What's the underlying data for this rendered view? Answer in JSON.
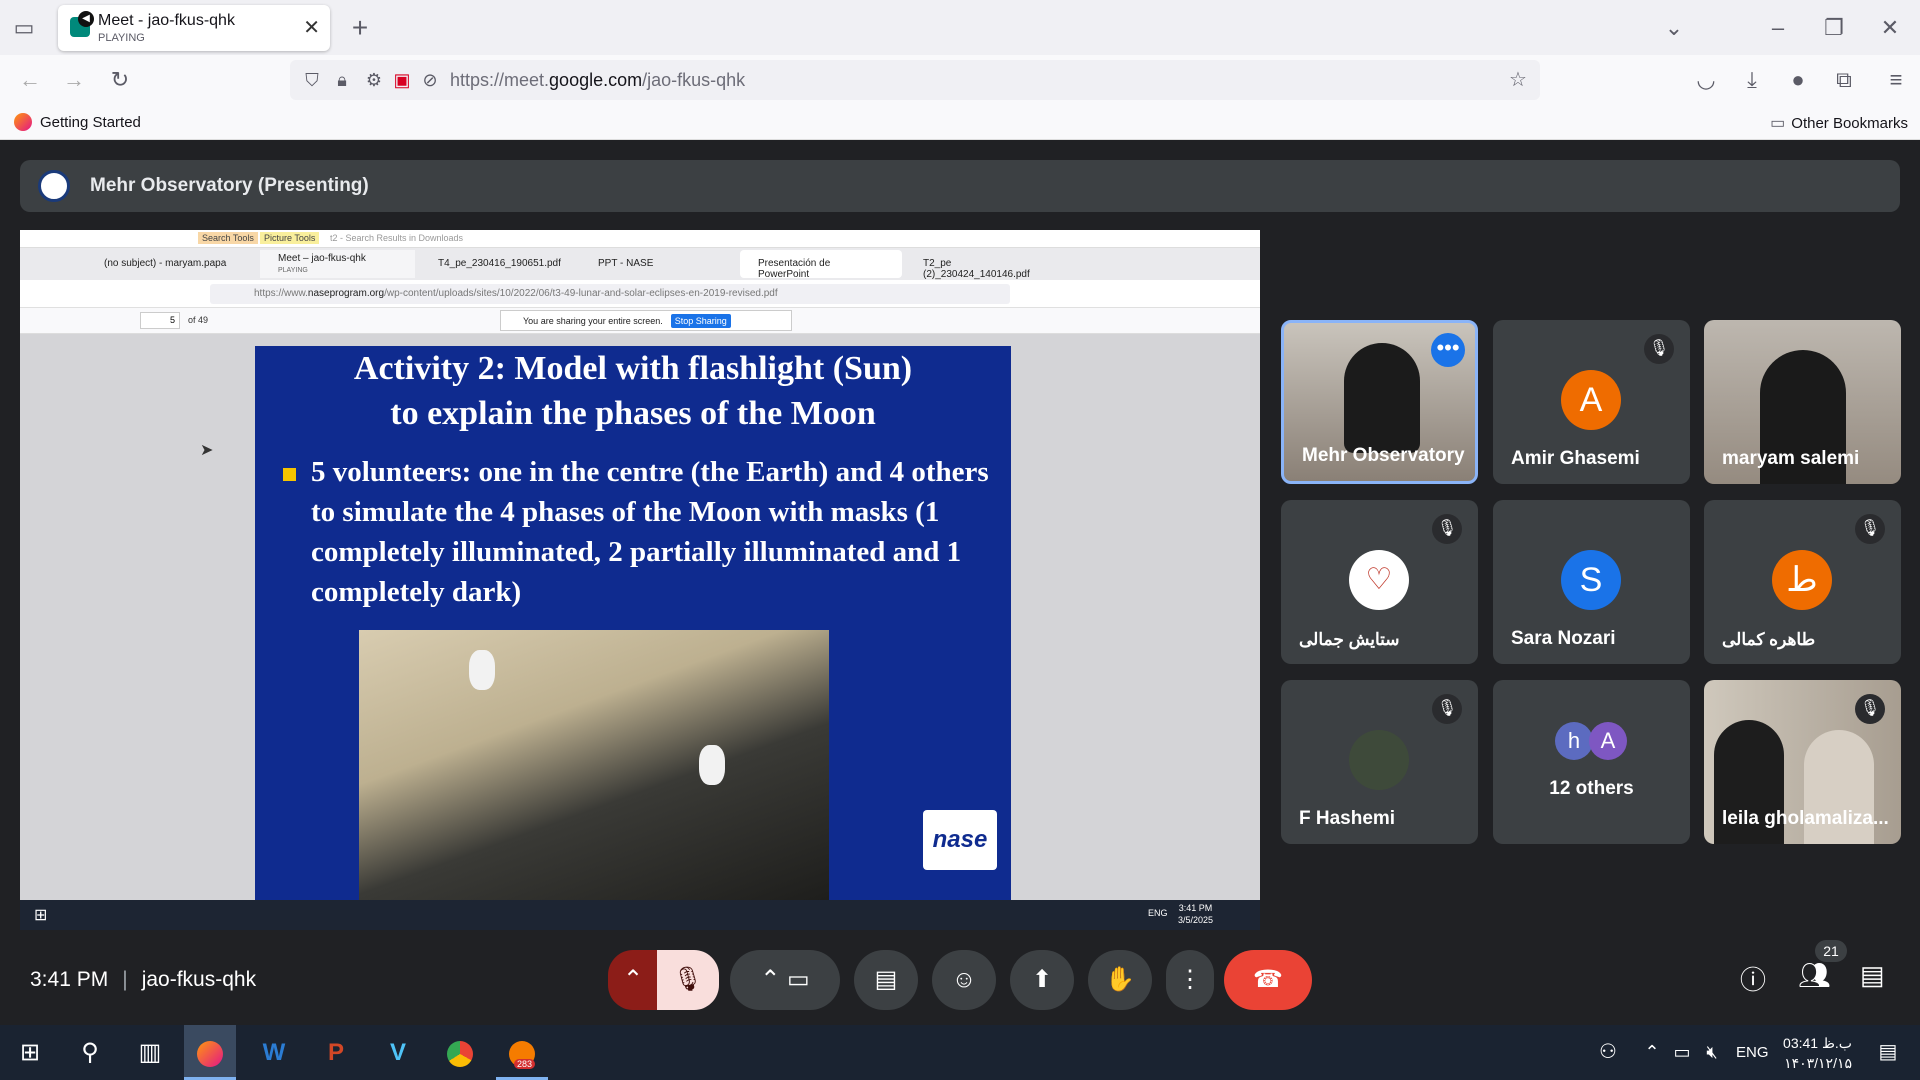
{
  "browser": {
    "tab_title": "Meet - jao-fkus-qhk",
    "tab_status": "PLAYING",
    "url_prefix": "https://meet.",
    "url_domain": "google.com",
    "url_path": "/jao-fkus-qhk",
    "bookmark": "Getting Started",
    "other_bookmarks": "Other Bookmarks"
  },
  "presenting": {
    "label": "Mehr Observatory (Presenting)"
  },
  "shared_screen": {
    "ribbon_search": "Search Tools",
    "ribbon_picture": "Picture Tools",
    "ribbon_doc": "t2 - Search Results in Downloads",
    "tabs": [
      {
        "label": "(no subject) - maryam.papa"
      },
      {
        "label": "Meet – jao-fkus-qhk",
        "sub": "PLAYING"
      },
      {
        "label": "T4_pe_230416_190651.pdf"
      },
      {
        "label": "PPT - NASE"
      },
      {
        "label": "Presentación de PowerPoint"
      },
      {
        "label": "T2_pe (2)_230424_140146.pdf"
      }
    ],
    "url_prefix": "https://www.",
    "url_domain": "naseprogram.org",
    "url_path": "/wp-content/uploads/sites/10/2022/06/t3-49-lunar-and-solar-eclipses-en-2019-revised.pdf",
    "page_num": "5",
    "page_of": "of 49",
    "sharing_msg": "You are sharing your entire screen.",
    "stop_sharing": "Stop Sharing",
    "slide_title_1": "Activity 2: Model with flashlight (Sun)",
    "slide_title_2": "to explain the phases of the Moon",
    "slide_bullet": "5 volunteers: one in the centre (the Earth) and 4 others to simulate the 4 phases of the Moon with masks (1 completely illuminated, 2 partially illuminated and 1 completely dark)",
    "nase_logo": "nase",
    "inner_time": "3:41 PM",
    "inner_date": "3/5/2025",
    "inner_lang": "ENG"
  },
  "participants": [
    {
      "name": "Mehr Observatory",
      "type": "video",
      "active": true
    },
    {
      "name": "Amir Ghasemi",
      "type": "letter",
      "letter": "A",
      "color": "#ef6c00",
      "muted": true
    },
    {
      "name": "maryam salemi",
      "type": "video"
    },
    {
      "name": "ستایش جمالی",
      "type": "image",
      "muted": true
    },
    {
      "name": "Sara Nozari",
      "type": "letter",
      "letter": "S",
      "color": "#1a73e8"
    },
    {
      "name": "طاهره کمالی",
      "type": "letter",
      "letter": "ط",
      "color": "#ef6c00",
      "muted": true
    },
    {
      "name": "F Hashemi",
      "type": "image",
      "muted": true
    },
    {
      "name": "12 others",
      "type": "others",
      "letters": [
        "h",
        "A"
      ]
    },
    {
      "name": "leila gholamaliza...",
      "type": "video",
      "muted": true
    }
  ],
  "bottom": {
    "time": "3:41 PM",
    "meeting_code": "jao-fkus-qhk",
    "people_count": "21"
  },
  "taskbar": {
    "lang": "ENG",
    "time": "03:41 ب.ظ",
    "date": "۱۴۰۳/۱۲/۱۵",
    "badge": "283"
  }
}
